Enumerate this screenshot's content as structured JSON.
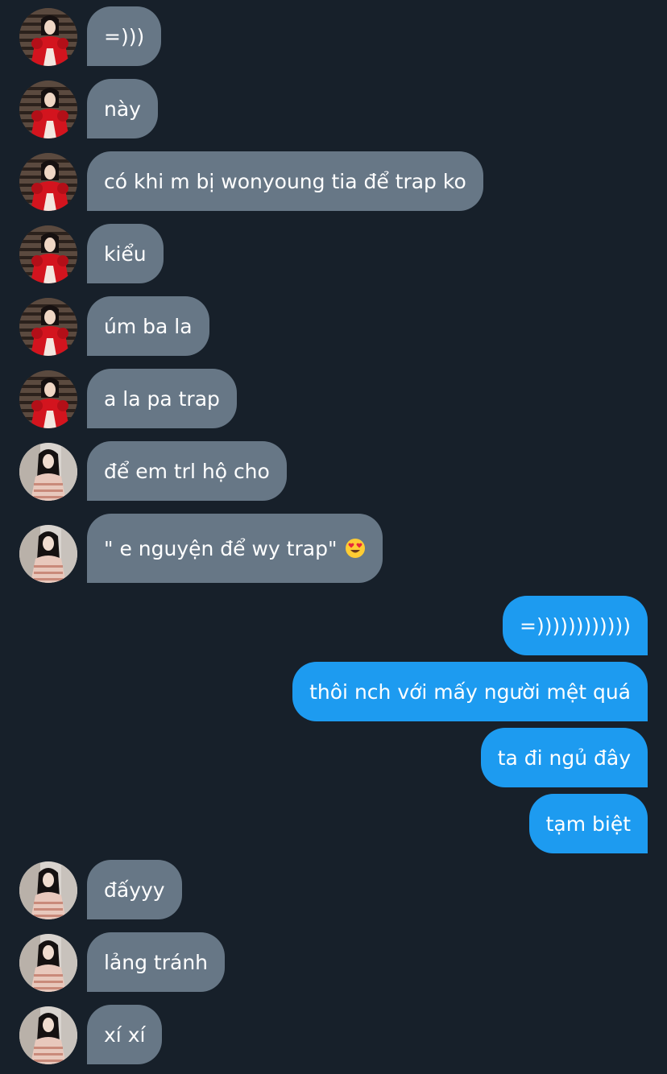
{
  "conversation": {
    "messages": [
      {
        "from": "user_a",
        "text": "=)))"
      },
      {
        "from": "user_a",
        "text": "này"
      },
      {
        "from": "user_a",
        "text": "có khi m bị wonyoung tia để trap ko"
      },
      {
        "from": "user_a",
        "text": "kiểu"
      },
      {
        "from": "user_a",
        "text": "úm ba la"
      },
      {
        "from": "user_a",
        "text": "a la pa trap"
      },
      {
        "from": "user_b",
        "text": "để em trl hộ cho"
      },
      {
        "from": "user_b",
        "text": "\" e nguyện để wy trap\"",
        "emoji": "heart-eyes-emoji"
      },
      {
        "from": "me",
        "text": "=))))))))))))"
      },
      {
        "from": "me",
        "text": "thôi nch với mấy người mệt quá"
      },
      {
        "from": "me",
        "text": "ta đi ngủ đây"
      },
      {
        "from": "me",
        "text": "tạm biệt"
      },
      {
        "from": "user_b",
        "text": "đấyyy"
      },
      {
        "from": "user_b",
        "text": "lảng tránh"
      },
      {
        "from": "user_b",
        "text": "xí xí"
      }
    ]
  },
  "colors": {
    "background": "#17202a",
    "incoming_bubble": "#677786",
    "outgoing_bubble": "#1d9bf0",
    "text": "#ffffff"
  }
}
